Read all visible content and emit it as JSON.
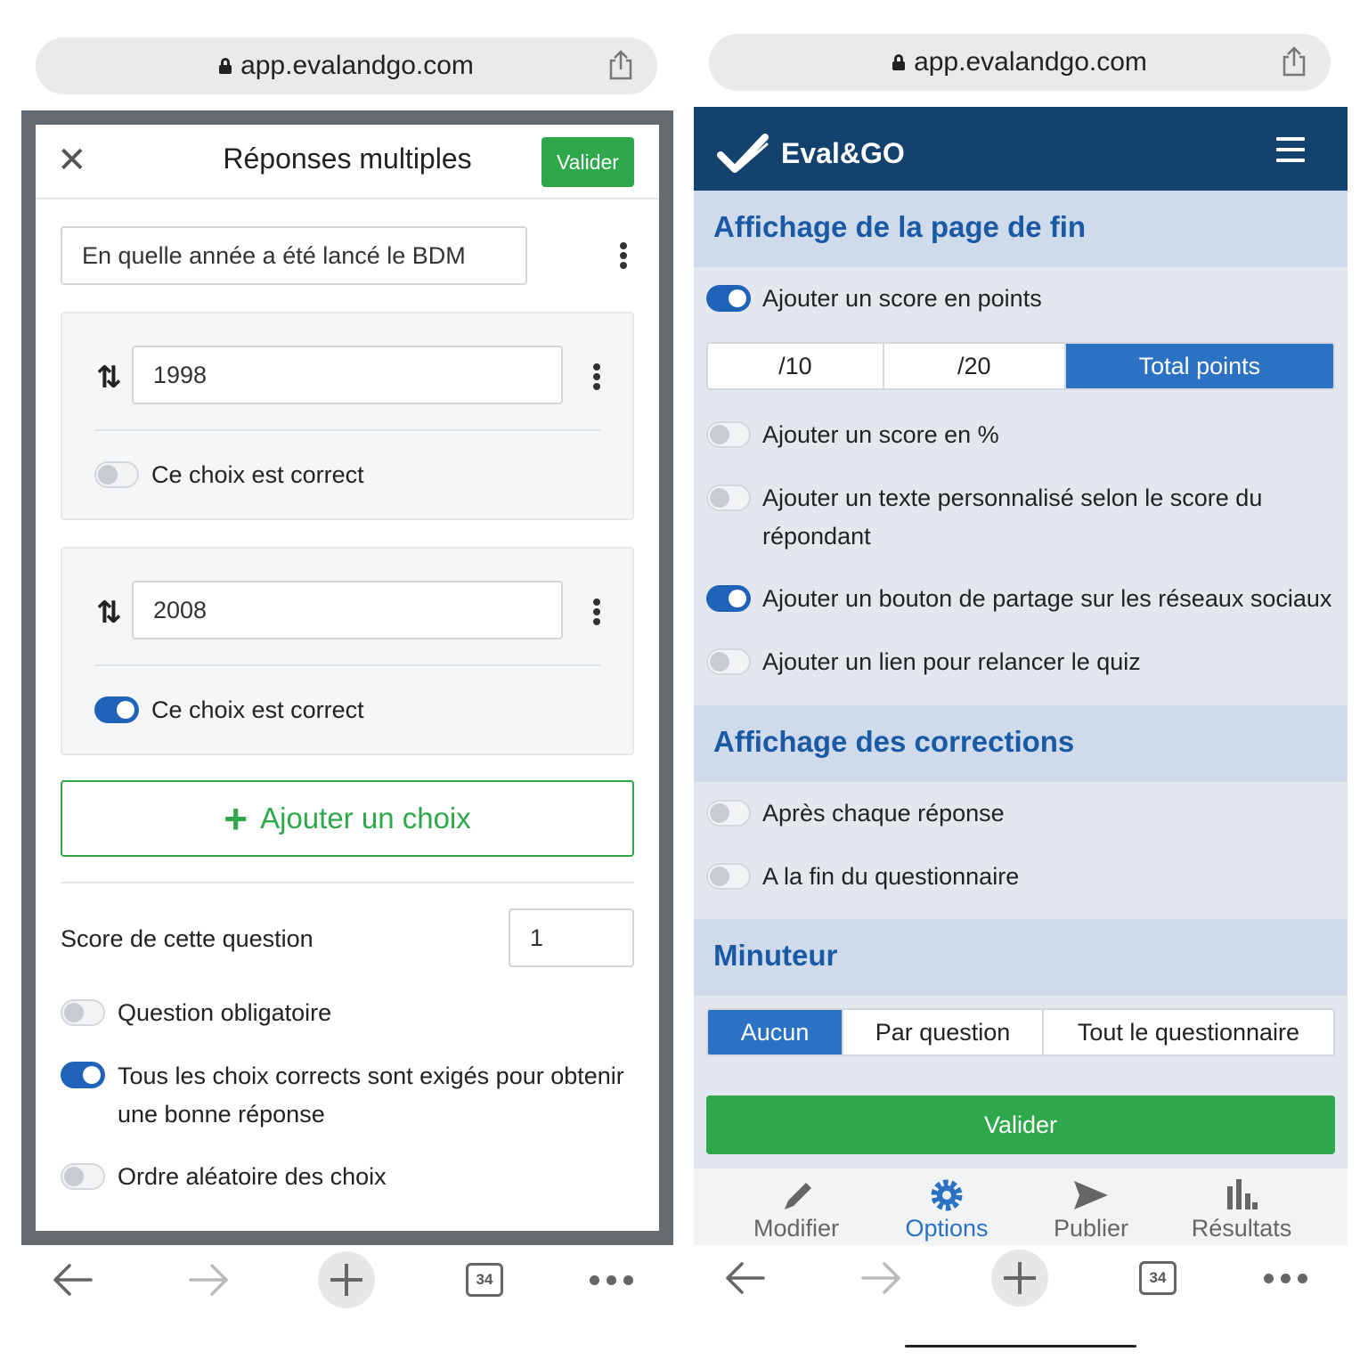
{
  "left": {
    "browser": {
      "url": "app.evalandgo.com",
      "tab_count": "34"
    },
    "modal": {
      "title": "Réponses multiples",
      "validate_label": "Valider",
      "question_text": "En quelle année a été lancé le BDM",
      "choices": [
        {
          "value": "1998",
          "correct_label": "Ce choix est correct",
          "correct": false
        },
        {
          "value": "2008",
          "correct_label": "Ce choix est correct",
          "correct": true
        }
      ],
      "add_choice_label": "Ajouter un choix",
      "score_label": "Score de cette question",
      "score_value": "1",
      "options": [
        {
          "label": "Question obligatoire",
          "on": false
        },
        {
          "label": "Tous les choix corrects sont exigés pour obtenir une bonne réponse",
          "on": true
        },
        {
          "label": "Ordre aléatoire des choix",
          "on": false
        }
      ]
    }
  },
  "right": {
    "browser": {
      "url": "app.evalandgo.com",
      "tab_count": "34"
    },
    "brand": "Eval&GO",
    "sections": {
      "end_page": {
        "title": "Affichage de la page de fin",
        "score_points_label": "Ajouter un score en points",
        "score_points_on": true,
        "scale_options": [
          "/10",
          "/20",
          "Total points"
        ],
        "scale_selected": "Total points",
        "toggles": [
          {
            "label": "Ajouter un score en %",
            "on": false
          },
          {
            "label": "Ajouter un texte personnalisé selon le score du répondant",
            "on": false
          },
          {
            "label": "Ajouter un bouton de partage sur les réseaux sociaux",
            "on": true
          },
          {
            "label": "Ajouter un lien pour relancer le quiz",
            "on": false
          }
        ]
      },
      "corrections": {
        "title": "Affichage des corrections",
        "toggles": [
          {
            "label": "Après chaque réponse",
            "on": false
          },
          {
            "label": "A la fin du questionnaire",
            "on": false
          }
        ]
      },
      "timer": {
        "title": "Minuteur",
        "options": [
          "Aucun",
          "Par question",
          "Tout le questionnaire"
        ],
        "selected": "Aucun"
      }
    },
    "validate_label": "Valider",
    "tabs": [
      {
        "label": "Modifier",
        "icon": "pencil-icon",
        "active": false
      },
      {
        "label": "Options",
        "icon": "gear-icon",
        "active": true
      },
      {
        "label": "Publier",
        "icon": "send-icon",
        "active": false
      },
      {
        "label": "Résultats",
        "icon": "bar-chart-icon",
        "active": false
      }
    ]
  },
  "colors": {
    "green": "#2ea84a",
    "navy": "#14426f",
    "blue_accent": "#2b72c2",
    "section_blue": "#1a5aa5"
  }
}
